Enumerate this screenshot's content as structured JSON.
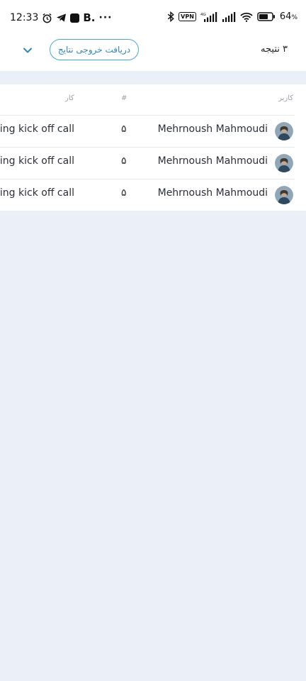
{
  "status_bar": {
    "time": "12:33",
    "b_label": "B.",
    "more_dots": "···",
    "vpn": "VPN",
    "network": "4G",
    "battery_percent": "64",
    "battery_unit": "%"
  },
  "header": {
    "result_count": "۳ نتیجه",
    "export_button": "دریافت خروجی نتایج"
  },
  "table": {
    "columns": {
      "user": "کاربر",
      "number": "#",
      "task": "کار"
    },
    "rows": [
      {
        "user": "Mehrnoush Mahmoudi",
        "number": "۵",
        "task": "ing kick off call"
      },
      {
        "user": "Mehrnoush Mahmoudi",
        "number": "۵",
        "task": "ing kick off call"
      },
      {
        "user": "Mehrnoush Mahmoudi",
        "number": "۵",
        "task": "ing kick off call"
      }
    ]
  },
  "colors": {
    "accent": "#4aa7d6",
    "page_background": "#ebeff8"
  }
}
